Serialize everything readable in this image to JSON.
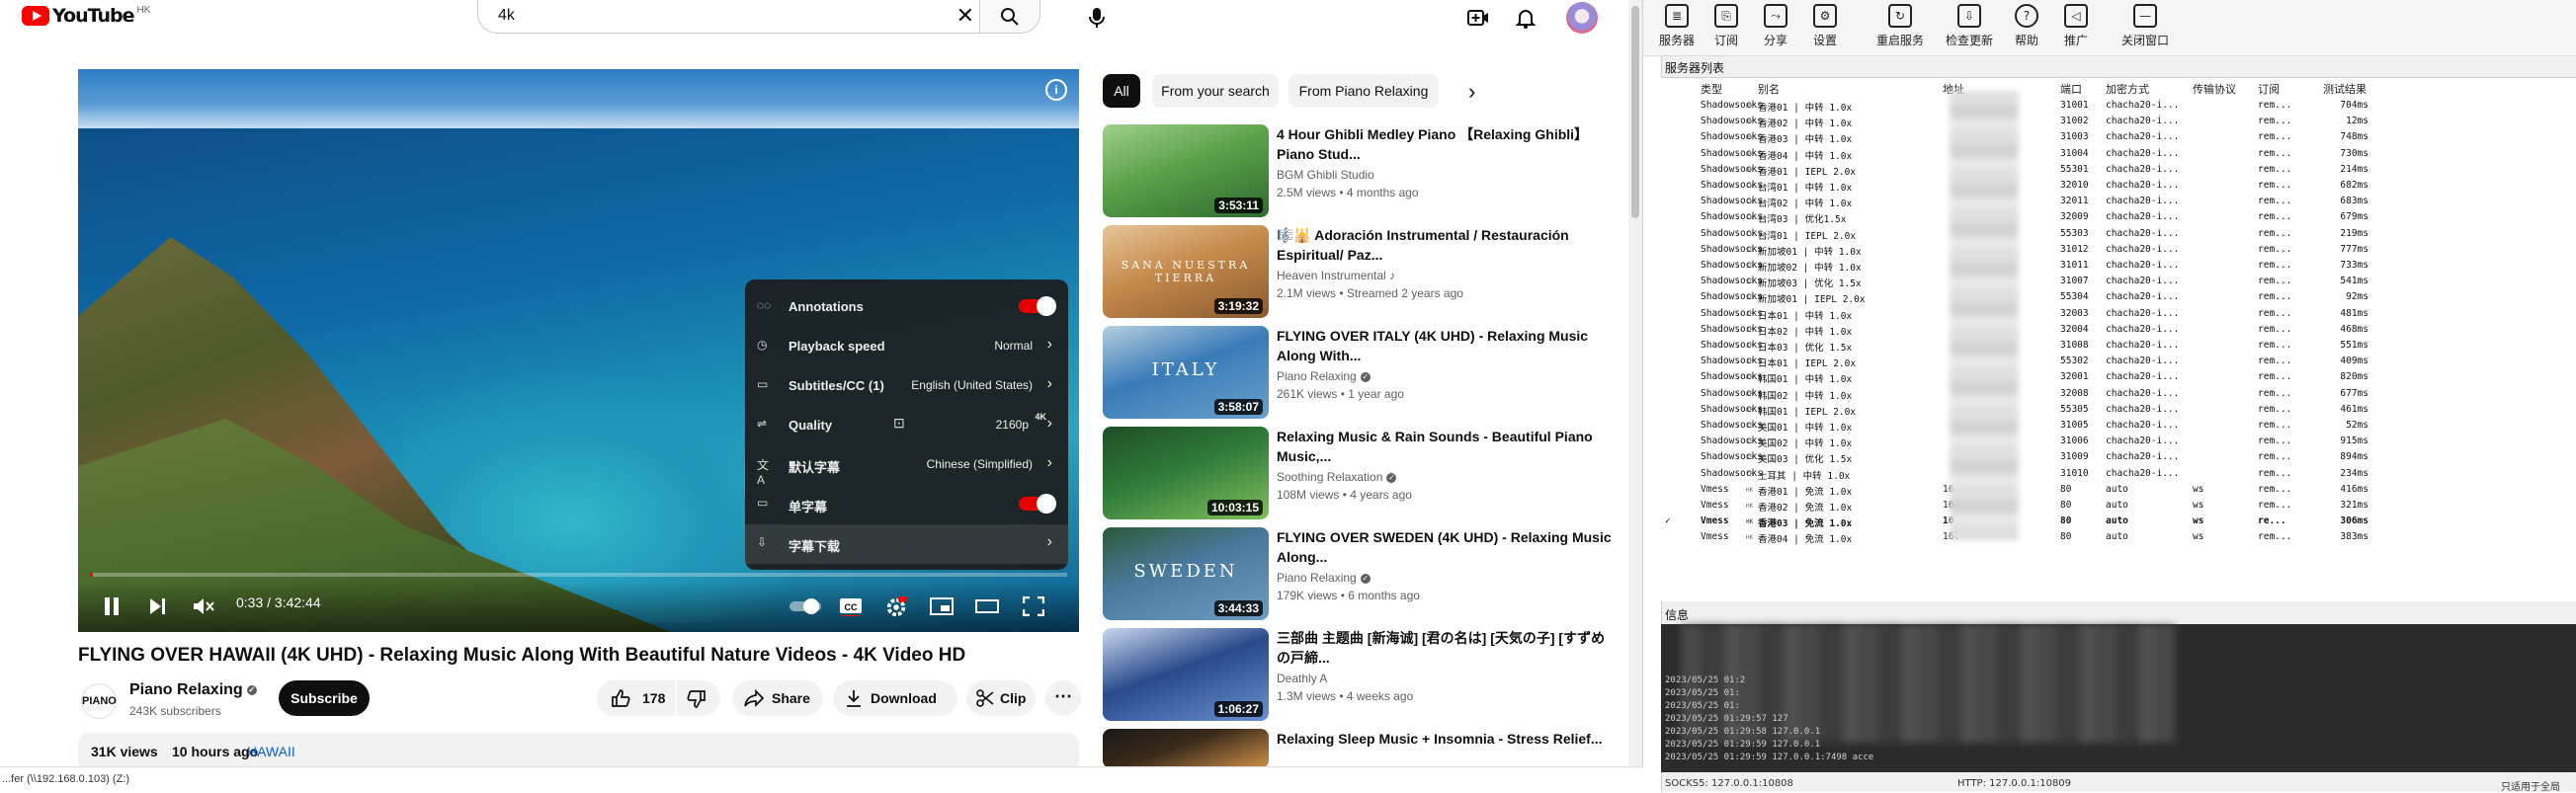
{
  "youtube": {
    "logo_text": "YouTube",
    "country_code": "HK",
    "search_query": "4k",
    "player": {
      "time_current": "0:33",
      "time_total": "3:42:44",
      "progress_fraction": 0.003
    },
    "settings_menu": [
      {
        "label": "Annotations",
        "value": "",
        "control": "toggle-on"
      },
      {
        "label": "Playback speed",
        "value": "Normal",
        "control": "chevron"
      },
      {
        "label": "Subtitles/CC (1)",
        "value": "English (United States)",
        "control": "chevron"
      },
      {
        "label": "Quality",
        "value": "2160p",
        "badge": "4K",
        "control": "chevron"
      },
      {
        "label": "默认字幕",
        "value": "Chinese (Simplified)",
        "control": "chevron"
      },
      {
        "label": "单字幕",
        "value": "",
        "control": "toggle-on"
      },
      {
        "label": "字幕下载",
        "value": "",
        "control": "chevron"
      }
    ],
    "video_title": "FLYING OVER HAWAII (4K UHD) - Relaxing Music Along With Beautiful Nature Videos - 4K Video HD",
    "channel": {
      "logo_text": "PIANO",
      "name": "Piano Relaxing",
      "subscribers": "243K subscribers",
      "subscribe_label": "Subscribe"
    },
    "actions": {
      "likes": "178",
      "share": "Share",
      "download": "Download",
      "clip": "Clip"
    },
    "stats": {
      "views": "31K views",
      "age": "10 hours ago",
      "tag": "HAWAII"
    },
    "chips": [
      "All",
      "From your search",
      "From Piano Relaxing"
    ],
    "recommendations": [
      {
        "title": "4 Hour Ghibli Medley Piano 【Relaxing Ghibli】Piano Stud...",
        "channel": "BGM Ghibli Studio",
        "meta": "2.5M views • 4 months ago",
        "duration": "3:53:11",
        "thumb_colors": [
          "#5aa14a",
          "#2f6b2e",
          "#9fd08a"
        ],
        "verified": false,
        "thumb_text": ""
      },
      {
        "title": "🎼🕌 Adoración Instrumental / Restauración Espiritual/ Paz...",
        "channel": "Heaven Instrumental ♪",
        "meta": "2.1M views • Streamed 2 years ago",
        "duration": "3:19:32",
        "thumb_colors": [
          "#c58a4a",
          "#8a5a30",
          "#e8c49a"
        ],
        "verified": false,
        "thumb_text": "SANA NUESTRA TIERRA"
      },
      {
        "title": "FLYING OVER ITALY (4K UHD) - Relaxing Music Along With...",
        "channel": "Piano Relaxing",
        "meta": "261K views • 1 year ago",
        "duration": "3:58:07",
        "thumb_colors": [
          "#3a7bb8",
          "#6aa0c8",
          "#b4cfe0"
        ],
        "verified": true,
        "thumb_text": "ITALY"
      },
      {
        "title": "Relaxing Music & Rain Sounds - Beautiful Piano Music,...",
        "channel": "Soothing Relaxation",
        "meta": "108M views • 4 years ago",
        "duration": "10:03:15",
        "thumb_colors": [
          "#2f7a3a",
          "#7fbf5a",
          "#1e4f24"
        ],
        "verified": true,
        "thumb_text": ""
      },
      {
        "title": "FLYING OVER SWEDEN (4K UHD) - Relaxing Music Along...",
        "channel": "Piano Relaxing",
        "meta": "179K views • 6 months ago",
        "duration": "3:44:33",
        "thumb_colors": [
          "#4a7aa0",
          "#6c9cbf",
          "#2d5a3a"
        ],
        "verified": true,
        "thumb_text": "SWEDEN"
      },
      {
        "title": "三部曲 主题曲 [新海诚] [君の名は] [天気の子] [すずめの戸締...",
        "channel": "Deathly A",
        "meta": "1.3M views • 4 weeks ago",
        "duration": "1:06:27",
        "thumb_colors": [
          "#2a4a8a",
          "#6a8fd0",
          "#c8d8f0"
        ],
        "verified": false,
        "thumb_text": ""
      },
      {
        "title": "Relaxing Sleep Music + Insomnia - Stress Relief...",
        "channel": "",
        "meta": "",
        "duration": "",
        "thumb_colors": [
          "#3a2a1a",
          "#d0904a",
          "#1a1a1a"
        ],
        "verified": false,
        "thumb_text": ""
      }
    ],
    "taskbar_text": "...fer (\\\\192.168.0.103) (Z:)"
  },
  "v2rayn": {
    "toolbar": [
      {
        "label": "服务器",
        "icon": "server-icon"
      },
      {
        "label": "订阅",
        "icon": "subscription-icon"
      },
      {
        "label": "分享",
        "icon": "share-icon"
      },
      {
        "label": "设置",
        "icon": "gear-icon"
      },
      {
        "label": "重启服务",
        "icon": "restart-icon"
      },
      {
        "label": "检查更新",
        "icon": "update-icon"
      },
      {
        "label": "帮助",
        "icon": "help-icon"
      },
      {
        "label": "推广",
        "icon": "promote-icon"
      },
      {
        "label": "关闭窗口",
        "icon": "minimize-icon"
      }
    ],
    "group_label": "服务器列表",
    "columns": [
      "类型",
      "别名",
      "地址",
      "端口",
      "加密方式",
      "传输协议",
      "订阅",
      "测试结果"
    ],
    "rows": [
      {
        "type": "Shadowsocks",
        "cc": "HK",
        "alias": "香港01 | 中转 1.0x",
        "addr": "",
        "port": "31001",
        "enc": "chacha20-i...",
        "net": "",
        "sub": "rem...",
        "result": "704ms",
        "active": false
      },
      {
        "type": "Shadowsocks",
        "cc": "HK",
        "alias": "香港02 | 中转 1.0x",
        "addr": "",
        "port": "31002",
        "enc": "chacha20-i...",
        "net": "",
        "sub": "rem...",
        "result": "12ms",
        "active": false
      },
      {
        "type": "Shadowsocks",
        "cc": "HK",
        "alias": "香港03 | 中转 1.0x",
        "addr": "",
        "port": "31003",
        "enc": "chacha20-i...",
        "net": "",
        "sub": "rem...",
        "result": "748ms",
        "active": false
      },
      {
        "type": "Shadowsocks",
        "cc": "HK",
        "alias": "香港04 | 中转 1.0x",
        "addr": "",
        "port": "31004",
        "enc": "chacha20-i...",
        "net": "",
        "sub": "rem...",
        "result": "730ms",
        "active": false
      },
      {
        "type": "Shadowsocks",
        "cc": "HK",
        "alias": "香港01 | IEPL 2.0x",
        "addr": "",
        "port": "55301",
        "enc": "chacha20-i...",
        "net": "",
        "sub": "rem...",
        "result": "214ms",
        "active": false
      },
      {
        "type": "Shadowsocks",
        "cc": "CN",
        "alias": "台湾01 | 中转 1.0x",
        "addr": "",
        "port": "32010",
        "enc": "chacha20-i...",
        "net": "",
        "sub": "rem...",
        "result": "682ms",
        "active": false
      },
      {
        "type": "Shadowsocks",
        "cc": "CN",
        "alias": "台湾02 | 中转 1.0x",
        "addr": "",
        "port": "32011",
        "enc": "chacha20-i...",
        "net": "",
        "sub": "rem...",
        "result": "683ms",
        "active": false
      },
      {
        "type": "Shadowsocks",
        "cc": "CN",
        "alias": "台湾03 | 优化1.5x",
        "addr": "",
        "port": "32009",
        "enc": "chacha20-i...",
        "net": "",
        "sub": "rem...",
        "result": "679ms",
        "active": false
      },
      {
        "type": "Shadowsocks",
        "cc": "CN",
        "alias": "台湾01 | IEPL 2.0x",
        "addr": "",
        "port": "55303",
        "enc": "chacha20-i...",
        "net": "",
        "sub": "rem...",
        "result": "219ms",
        "active": false
      },
      {
        "type": "Shadowsocks",
        "cc": "SG",
        "alias": "新加坡01 | 中转 1.0x",
        "addr": "",
        "port": "31012",
        "enc": "chacha20-i...",
        "net": "",
        "sub": "rem...",
        "result": "777ms",
        "active": false
      },
      {
        "type": "Shadowsocks",
        "cc": "SG",
        "alias": "新加坡02 | 中转 1.0x",
        "addr": "",
        "port": "31011",
        "enc": "chacha20-i...",
        "net": "",
        "sub": "rem...",
        "result": "733ms",
        "active": false
      },
      {
        "type": "Shadowsocks",
        "cc": "SG",
        "alias": "新加坡03 | 优化 1.5x",
        "addr": "",
        "port": "31007",
        "enc": "chacha20-i...",
        "net": "",
        "sub": "rem...",
        "result": "541ms",
        "active": false
      },
      {
        "type": "Shadowsocks",
        "cc": "SG",
        "alias": "新加坡01 | IEPL 2.0x",
        "addr": "",
        "port": "55304",
        "enc": "chacha20-i...",
        "net": "",
        "sub": "rem...",
        "result": "92ms",
        "active": false
      },
      {
        "type": "Shadowsocks",
        "cc": "JP",
        "alias": "日本01 | 中转 1.0x",
        "addr": "",
        "port": "32003",
        "enc": "chacha20-i...",
        "net": "",
        "sub": "rem...",
        "result": "481ms",
        "active": false
      },
      {
        "type": "Shadowsocks",
        "cc": "JP",
        "alias": "日本02 | 中转 1.0x",
        "addr": "",
        "port": "32004",
        "enc": "chacha20-i...",
        "net": "",
        "sub": "rem...",
        "result": "468ms",
        "active": false
      },
      {
        "type": "Shadowsocks",
        "cc": "JP",
        "alias": "日本03 | 优化 1.5x",
        "addr": "",
        "port": "31008",
        "enc": "chacha20-i...",
        "net": "",
        "sub": "rem...",
        "result": "551ms",
        "active": false
      },
      {
        "type": "Shadowsocks",
        "cc": "JP",
        "alias": "日本01 | IEPL 2.0x",
        "addr": "",
        "port": "55302",
        "enc": "chacha20-i...",
        "net": "",
        "sub": "rem...",
        "result": "409ms",
        "active": false
      },
      {
        "type": "Shadowsocks",
        "cc": "KR",
        "alias": "韩国01 | 中转 1.0x",
        "addr": "",
        "port": "32001",
        "enc": "chacha20-i...",
        "net": "",
        "sub": "rem...",
        "result": "820ms",
        "active": false
      },
      {
        "type": "Shadowsocks",
        "cc": "KR",
        "alias": "韩国02 | 中转 1.0x",
        "addr": "",
        "port": "32008",
        "enc": "chacha20-i...",
        "net": "",
        "sub": "rem...",
        "result": "677ms",
        "active": false
      },
      {
        "type": "Shadowsocks",
        "cc": "KR",
        "alias": "韩国01 | IEPL 2.0x",
        "addr": "",
        "port": "55305",
        "enc": "chacha20-i...",
        "net": "",
        "sub": "rem...",
        "result": "461ms",
        "active": false
      },
      {
        "type": "Shadowsocks",
        "cc": "US",
        "alias": "美国01 | 中转 1.0x",
        "addr": "",
        "port": "31005",
        "enc": "chacha20-i...",
        "net": "",
        "sub": "rem...",
        "result": "52ms",
        "active": false
      },
      {
        "type": "Shadowsocks",
        "cc": "US",
        "alias": "美国02 | 中转 1.0x",
        "addr": "",
        "port": "31006",
        "enc": "chacha20-i...",
        "net": "",
        "sub": "rem...",
        "result": "915ms",
        "active": false
      },
      {
        "type": "Shadowsocks",
        "cc": "US",
        "alias": "美国03 | 优化 1.5x",
        "addr": "",
        "port": "31009",
        "enc": "chacha20-i...",
        "net": "",
        "sub": "rem...",
        "result": "894ms",
        "active": false
      },
      {
        "type": "Shadowsocks",
        "cc": "TR",
        "alias": "土耳其 | 中转 1.0x",
        "addr": "",
        "port": "31010",
        "enc": "chacha20-i...",
        "net": "",
        "sub": "rem...",
        "result": "234ms",
        "active": false
      },
      {
        "type": "Vmess",
        "cc": "HK",
        "alias": "香港01 | 免流 1.0x",
        "addr": "16",
        "port": "80",
        "enc": "auto",
        "net": "ws",
        "sub": "rem...",
        "result": "416ms",
        "active": false
      },
      {
        "type": "Vmess",
        "cc": "HK",
        "alias": "香港02 | 免流 1.0x",
        "addr": "16",
        "port": "80",
        "enc": "auto",
        "net": "ws",
        "sub": "rem...",
        "result": "321ms",
        "active": false
      },
      {
        "type": "Vmess",
        "cc": "HK",
        "alias": "香港03 | 免流 1.0x",
        "addr": "16",
        "port": "80",
        "enc": "auto",
        "net": "ws",
        "sub": "re...",
        "result": "306ms",
        "active": true
      },
      {
        "type": "Vmess",
        "cc": "HK",
        "alias": "香港04 | 免流 1.0x",
        "addr": "16.",
        "port": "80",
        "enc": "auto",
        "net": "ws",
        "sub": "rem...",
        "result": "383ms",
        "active": false
      }
    ],
    "info_label": "信息",
    "log_lines": [
      "2023/05/25 01:2",
      "2023/05/25 01:",
      "2023/05/25 01:",
      "2023/05/25 01:29:57 127",
      "2023/05/25 01:29:58 127.0.0.1",
      "2023/05/25 01:29:59 127.0.0.1",
      "2023/05/25 01:29:59 127.0.0.1:7498 acce"
    ],
    "status": {
      "socks": "SOCKS5: 127.0.0.1:10808",
      "http": "HTTP: 127.0.0.1:10809",
      "right": "只适用于全局"
    }
  }
}
